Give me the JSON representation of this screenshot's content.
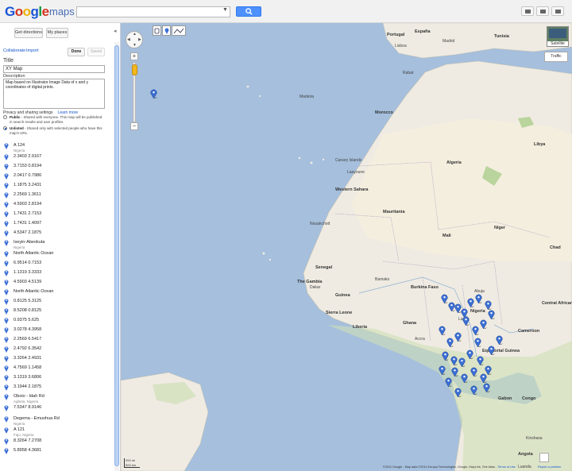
{
  "header": {
    "logo_letters": [
      "G",
      "o",
      "o",
      "g",
      "l",
      "e"
    ],
    "logo_suffix": "maps",
    "search_value": "",
    "search_button_icon": "search-icon",
    "toolbar_icons": [
      "print-icon",
      "email-icon",
      "link-icon"
    ]
  },
  "sidebar": {
    "get_directions_label": "Get directions",
    "my_places_label": "My places",
    "collaborate_label": "Collaborate",
    "import_label": "Import",
    "done_label": "Done",
    "saved_label": "Saved",
    "title_label": "Title",
    "title_value": "XY Map",
    "description_label": "Description",
    "description_value": "Map based on Illustrator Image Data of x and y coordinates of digital prints.",
    "privacy_label": "Privacy and sharing settings",
    "learn_more_label": "Learn more",
    "public_title": "Public",
    "public_text": " - Shared with everyone. This map will be published in search results and user profiles.",
    "unlisted_title": "Unlisted",
    "unlisted_text": " - Shared only with selected people who have this map's URL.",
    "selected_privacy": "Unlisted",
    "places": [
      {
        "name": "A 124",
        "sub": "Nigeria"
      },
      {
        "name": "2.3403 2.9167",
        "sub": ""
      },
      {
        "name": "3.7153 0.8194",
        "sub": ""
      },
      {
        "name": "2.0417 0.7986",
        "sub": ""
      },
      {
        "name": "1.1875 3.2431",
        "sub": ""
      },
      {
        "name": "2.2569 1.3611",
        "sub": ""
      },
      {
        "name": "4.5903 2.8194",
        "sub": ""
      },
      {
        "name": "1.7431 2.7153",
        "sub": ""
      },
      {
        "name": "1.7431 1.4097",
        "sub": ""
      },
      {
        "name": "4.5347 2.1875",
        "sub": ""
      },
      {
        "name": "Iseyin-Abeokuta",
        "sub": "Nigeria"
      },
      {
        "name": "North Atlantic Ocean",
        "sub": ""
      },
      {
        "name": "6.9514 0.7153",
        "sub": ""
      },
      {
        "name": "1.1319 3.3333",
        "sub": ""
      },
      {
        "name": "4.5903 4.5139",
        "sub": ""
      },
      {
        "name": "North Atlantic Ocean",
        "sub": ""
      },
      {
        "name": "0.8125 5.3125",
        "sub": ""
      },
      {
        "name": "8.5208 0.8125",
        "sub": ""
      },
      {
        "name": "0.9375 5.625",
        "sub": ""
      },
      {
        "name": "3.0278 4.3958",
        "sub": ""
      },
      {
        "name": "2.2569 6.5417",
        "sub": ""
      },
      {
        "name": "2.4792 6.3542",
        "sub": ""
      },
      {
        "name": "3.3264 2.4931",
        "sub": ""
      },
      {
        "name": "4.7569 1.1458",
        "sub": ""
      },
      {
        "name": "3.1319 3.6806",
        "sub": ""
      },
      {
        "name": "3.1944 2.1875",
        "sub": ""
      },
      {
        "name": "Oboio - Idah Rd",
        "sub": "Agbeta, Nigeria"
      },
      {
        "name": "7.5347 8.9146",
        "sub": ""
      },
      {
        "name": "Degema - Emuohua Rd",
        "sub": "Nigeria"
      },
      {
        "name": "A 121",
        "sub": "Fajo, Nigeria"
      },
      {
        "name": "8.3264 7.2708",
        "sub": ""
      },
      {
        "name": "5.8958 4.3681",
        "sub": ""
      }
    ]
  },
  "map": {
    "water_color": "#a5bfdd",
    "land_color": "#efebe2",
    "pin_color": "#3b6fd4",
    "satellite_label": "Satellite",
    "traffic_label": "Traffic",
    "scale_labels": [
      "200 mi",
      "500 km"
    ],
    "attribution": "©2011 Google - Map data ©2011 Europa Technologies, Google, MapLink, Tele Atlas -",
    "terms_label": "Terms of Use",
    "report_label": "Report a problem",
    "labels": [
      {
        "text": "Western Sahara",
        "kind": "country"
      },
      {
        "text": "Mauritania",
        "kind": "country"
      },
      {
        "text": "Mali",
        "kind": "country"
      },
      {
        "text": "Niger",
        "kind": "country"
      },
      {
        "text": "Algeria",
        "kind": "country"
      },
      {
        "text": "Morocco",
        "kind": "country"
      },
      {
        "text": "Libya",
        "kind": "country"
      },
      {
        "text": "Chad",
        "kind": "country"
      },
      {
        "text": "Senegal",
        "kind": "country"
      },
      {
        "text": "The Gambia",
        "kind": "country"
      },
      {
        "text": "Guinea",
        "kind": "country"
      },
      {
        "text": "Sierra Leone",
        "kind": "country"
      },
      {
        "text": "Liberia",
        "kind": "country"
      },
      {
        "text": "Ghana",
        "kind": "country"
      },
      {
        "text": "Burkina Faso",
        "kind": "country"
      },
      {
        "text": "Nigeria",
        "kind": "country"
      },
      {
        "text": "Cameroon",
        "kind": "country"
      },
      {
        "text": "Gabon",
        "kind": "country"
      },
      {
        "text": "Congo",
        "kind": "country"
      },
      {
        "text": "Angola",
        "kind": "country"
      },
      {
        "text": "Equatorial Guinea",
        "kind": "country"
      },
      {
        "text": "Central African Republic",
        "kind": "country"
      },
      {
        "text": "Portugal",
        "kind": "country"
      },
      {
        "text": "España",
        "kind": "country"
      },
      {
        "text": "Tunisia",
        "kind": "country"
      },
      {
        "text": "Canary Islands",
        "kind": "place"
      },
      {
        "text": "Madeira",
        "kind": "place"
      },
      {
        "text": "Dakar",
        "kind": "place"
      },
      {
        "text": "Bamako",
        "kind": "place"
      },
      {
        "text": "Accra",
        "kind": "place"
      },
      {
        "text": "Lagos",
        "kind": "place"
      },
      {
        "text": "Abuja",
        "kind": "place"
      },
      {
        "text": "Lisboa",
        "kind": "place"
      },
      {
        "text": "Madrid",
        "kind": "place"
      },
      {
        "text": "Rabat",
        "kind": "place"
      },
      {
        "text": "Laayoune",
        "kind": "place"
      },
      {
        "text": "Nouakchott",
        "kind": "place"
      },
      {
        "text": "Kinshasa",
        "kind": "place"
      },
      {
        "text": "Luanda",
        "kind": "place"
      }
    ]
  }
}
